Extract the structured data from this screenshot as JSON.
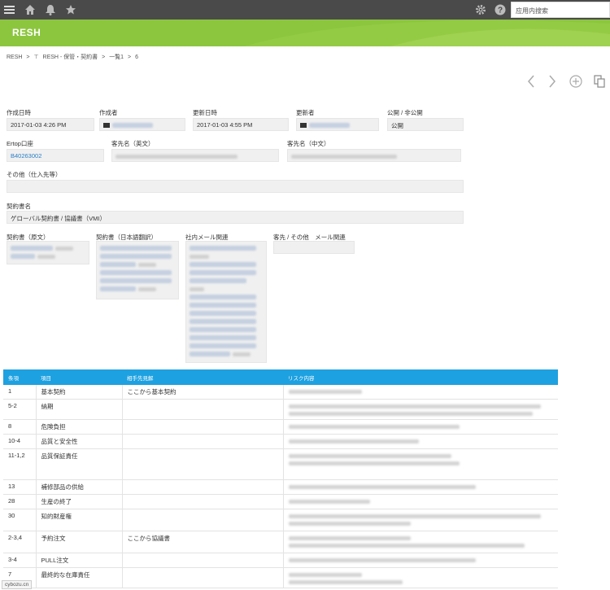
{
  "topbar": {
    "search_placeholder": "应用内搜索",
    "icons": [
      "menu-icon",
      "home-icon",
      "bell-icon",
      "star-icon",
      "gear-icon",
      "help-icon"
    ]
  },
  "app": {
    "title": "RESH"
  },
  "breadcrumb": {
    "items": [
      "RESH",
      ">",
      "RESH - 保管・契約書",
      ">",
      "一覧1",
      ">",
      "6"
    ]
  },
  "record": {
    "created_at_label": "作成日時",
    "created_at": "2017-01-03 4:26 PM",
    "creator_label": "作成者",
    "updated_at_label": "更新日時",
    "updated_at": "2017-01-03 4:55 PM",
    "updater_label": "更新者",
    "visibility_label": "公開 / 非公開",
    "visibility": "公開",
    "ertop_label": "Ertop口座",
    "ertop": "B40263002",
    "client_en_label": "客先名（英文）",
    "client_cn_label": "客先名（中文）",
    "other_label": "その他（仕入先等）",
    "contract_name_label": "契約書名",
    "contract_name": "ゲローバル契約書 / 協議書（VMI）",
    "orig_label": "契約書（原文）",
    "jp_label": "契約書（日本語翻訳）",
    "mail_label": "社内メール関連",
    "client_mail_label": "客先 / その他　メール関連"
  },
  "risk_table": {
    "headers": [
      "条項",
      "項目",
      "相手先見解",
      "リスク内容"
    ],
    "rows": [
      {
        "no": "1",
        "item": "基本契約",
        "view": "ここから基本契約"
      },
      {
        "no": "5-2",
        "item": "納期",
        "view": ""
      },
      {
        "no": "8",
        "item": "危険負担",
        "view": ""
      },
      {
        "no": "10-4",
        "item": "品質と安全性",
        "view": ""
      },
      {
        "no": "11-1,2",
        "item": "品質保証責任",
        "view": ""
      },
      {
        "no": "13",
        "item": "補修部品の供給",
        "view": ""
      },
      {
        "no": "28",
        "item": "生産の終了",
        "view": ""
      },
      {
        "no": "30",
        "item": "知的財産権",
        "view": ""
      },
      {
        "no": "2-3,4",
        "item": "予約注文",
        "view": "ここから協議書"
      },
      {
        "no": "3-4",
        "item": "PULL注文",
        "view": ""
      },
      {
        "no": "7",
        "item": "最終的な在庫責任",
        "view": ""
      }
    ]
  },
  "footer": {
    "url": "cybozu.cn"
  },
  "colors": {
    "appbar": "#8cc63f",
    "topbar": "#4a4a4a",
    "table_header": "#1ea1e0",
    "link": "#2a7ec7"
  }
}
